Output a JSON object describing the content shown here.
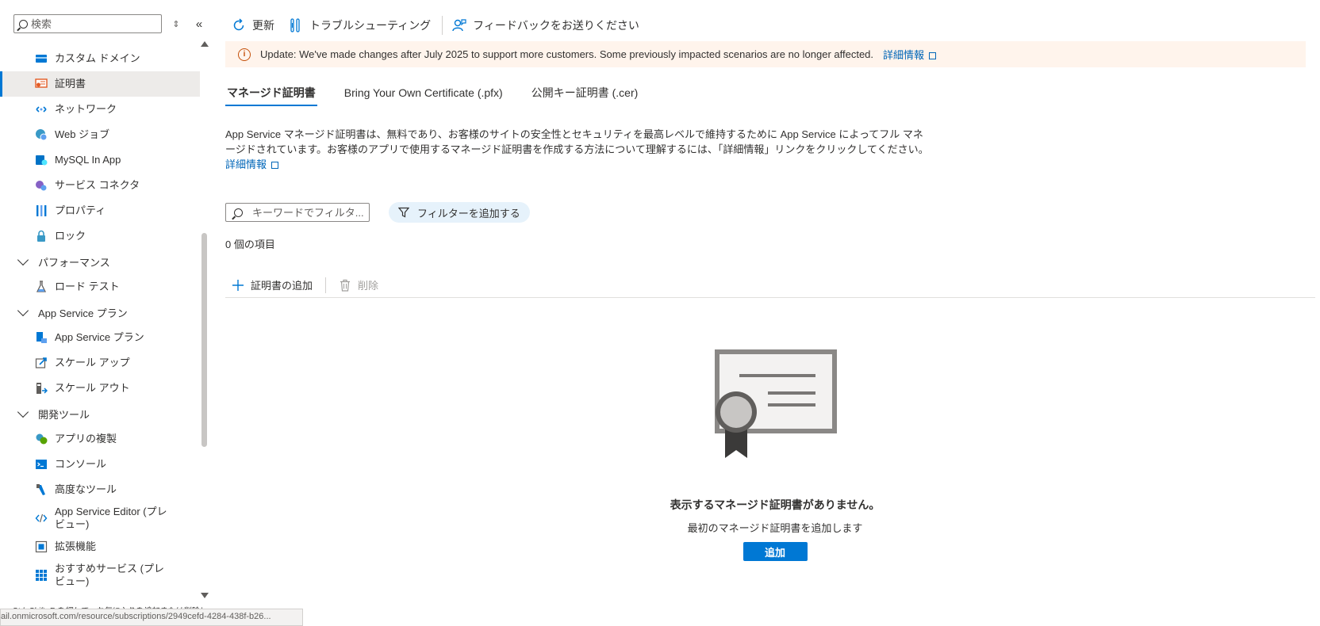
{
  "sidebar": {
    "search": {
      "placeholder": "検索",
      "value": ""
    },
    "items": [
      {
        "label": "カスタム ドメイン",
        "icon": "custom-domain-icon"
      },
      {
        "label": "証明書",
        "icon": "certificate-icon",
        "selected": true
      },
      {
        "label": "ネットワーク",
        "icon": "network-icon"
      },
      {
        "label": "Web ジョブ",
        "icon": "webjobs-icon"
      },
      {
        "label": "MySQL In App",
        "icon": "mysql-icon"
      },
      {
        "label": "サービス コネクタ",
        "icon": "service-connector-icon"
      },
      {
        "label": "プロパティ",
        "icon": "properties-icon"
      },
      {
        "label": "ロック",
        "icon": "lock-icon"
      }
    ],
    "groups": {
      "performance": {
        "label": "パフォーマンス",
        "items": [
          {
            "label": "ロード テスト",
            "icon": "load-test-icon"
          }
        ]
      },
      "plan": {
        "label": "App Service プラン",
        "items": [
          {
            "label": "App Service プラン",
            "icon": "app-service-plan-icon"
          },
          {
            "label": "スケール アップ",
            "icon": "scale-up-icon"
          },
          {
            "label": "スケール アウト",
            "icon": "scale-out-icon"
          }
        ]
      },
      "devtools": {
        "label": "開発ツール",
        "items": [
          {
            "label": "アプリの複製",
            "icon": "clone-app-icon"
          },
          {
            "label": "コンソール",
            "icon": "console-icon"
          },
          {
            "label": "高度なツール",
            "icon": "advanced-tools-icon"
          },
          {
            "label": "App Service Editor (プレビュー)",
            "icon": "code-editor-icon"
          },
          {
            "label": "拡張機能",
            "icon": "extensions-icon"
          },
          {
            "label": "おすすめサービス (プレビュー)",
            "icon": "grid-icon"
          }
        ]
      }
    },
    "hint": "Ctrl+Shift+F を押して、お気に入りを追加または削除しま",
    "status_url": "ail.onmicrosoft.com/resource/subscriptions/2949cefd-4284-438f-b26..."
  },
  "toolbar": {
    "refresh": "更新",
    "troubleshoot": "トラブルシューティング",
    "feedback": "フィードバックをお送りください"
  },
  "banner": {
    "text": "Update: We've made changes after July 2025 to support more customers. Some previously impacted scenarios are no longer affected.",
    "link": "詳細情報"
  },
  "tabs": [
    {
      "label": "マネージド証明書",
      "active": true
    },
    {
      "label": "Bring Your Own Certificate (.pfx)"
    },
    {
      "label": "公開キー証明書 (.cer)"
    }
  ],
  "description": {
    "text": "App Service マネージド証明書は、無料であり、お客様のサイトの安全性とセキュリティを最高レベルで維持するために App Service によってフル マネージドされています。お客様のアプリで使用するマネージド証明書を作成する方法について理解するには、「詳細情報」リンクをクリックしてください。",
    "link": "詳細情報"
  },
  "filter": {
    "placeholder": "キーワードでフィルタ...",
    "add_filter": "フィルターを追加する"
  },
  "count_text": "0 個の項目",
  "commands": {
    "add": "証明書の追加",
    "delete": "削除"
  },
  "empty_state": {
    "title": "表示するマネージド証明書がありません。",
    "subtitle": "最初のマネージド証明書を追加します",
    "button": "追加"
  },
  "colors": {
    "accent": "#0078d4",
    "link": "#0066b8",
    "banner_bg": "#fff4ec",
    "banner_icon": "#c4500a"
  }
}
